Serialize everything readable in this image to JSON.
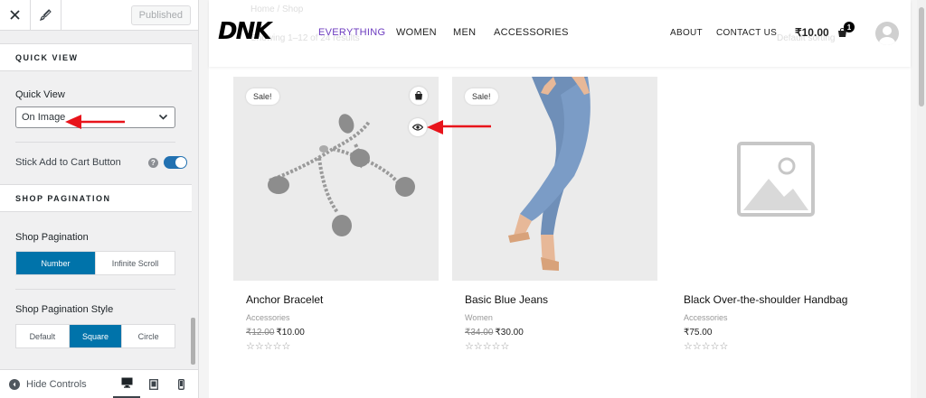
{
  "customizer": {
    "top": {
      "published_label": "Published"
    },
    "quick_view_section": "QUICK VIEW",
    "quick_view_label": "Quick View",
    "quick_view_value": "On Image",
    "sticky_label": "Stick Add to Cart Button",
    "help_glyph": "?",
    "sticky_enabled": true,
    "pagination_section": "SHOP PAGINATION",
    "pagination_label": "Shop Pagination",
    "pagination_options": [
      "Number",
      "Infinite Scroll"
    ],
    "pagination_selected": "Number",
    "pagination_style_label": "Shop Pagination Style",
    "style_options": [
      "Default",
      "Square",
      "Circle"
    ],
    "style_selected": "Square",
    "hide_controls": "Hide Controls"
  },
  "site": {
    "logo": "DNK",
    "nav": [
      "EVERYTHING",
      "WOMEN",
      "MEN",
      "ACCESSORIES"
    ],
    "nav_active": "EVERYTHING",
    "secondary_nav": [
      "ABOUT",
      "CONTACT US"
    ],
    "cart_total": "₹10.00",
    "cart_count": "1",
    "ghost_breadcrumb": "Home / Shop",
    "ghost_results": "Showing 1–12 of 24 results",
    "ghost_sort": "Default sorting",
    "products": [
      {
        "title": "Anchor Bracelet",
        "category": "Accessories",
        "old_price": "₹12.00",
        "price": "₹10.00",
        "sale_badge": "Sale!",
        "stars": "☆☆☆☆☆"
      },
      {
        "title": "Basic Blue Jeans",
        "category": "Women",
        "old_price": "₹34.00",
        "price": "₹30.00",
        "sale_badge": "Sale!",
        "stars": "☆☆☆☆☆"
      },
      {
        "title": "Black Over-the-shoulder Handbag",
        "category": "Accessories",
        "old_price": "",
        "price": "₹75.00",
        "sale_badge": "",
        "stars": "☆☆☆☆☆"
      }
    ]
  },
  "colors": {
    "accent_blue": "#0073aa",
    "nav_active": "#6c3bbf",
    "arrow_red": "#e8141b"
  },
  "icons": [
    "close-icon",
    "brush-icon",
    "chevron-down-icon",
    "desktop-icon",
    "tablet-icon",
    "mobile-icon",
    "cart-icon",
    "eye-icon",
    "bag-icon"
  ]
}
